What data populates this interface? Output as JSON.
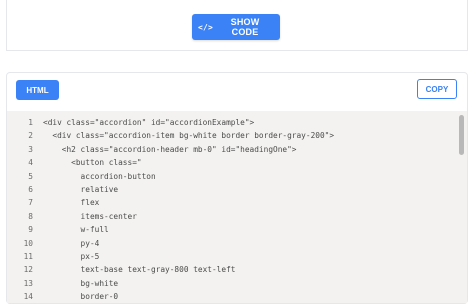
{
  "preview": {
    "show_code_label": "SHOW CODE",
    "icon_glyph": "</>"
  },
  "panel": {
    "tab_label": "HTML",
    "copy_label": "COPY"
  },
  "code_lines": [
    {
      "n": "1",
      "text": "<div class=\"accordion\" id=\"accordionExample\">"
    },
    {
      "n": "2",
      "text": "  <div class=\"accordion-item bg-white border border-gray-200\">"
    },
    {
      "n": "3",
      "text": "    <h2 class=\"accordion-header mb-0\" id=\"headingOne\">"
    },
    {
      "n": "4",
      "text": "      <button class=\""
    },
    {
      "n": "5",
      "text": "        accordion-button"
    },
    {
      "n": "6",
      "text": "        relative"
    },
    {
      "n": "7",
      "text": "        flex"
    },
    {
      "n": "8",
      "text": "        items-center"
    },
    {
      "n": "9",
      "text": "        w-full"
    },
    {
      "n": "10",
      "text": "        py-4"
    },
    {
      "n": "11",
      "text": "        px-5"
    },
    {
      "n": "12",
      "text": "        text-base text-gray-800 text-left"
    },
    {
      "n": "13",
      "text": "        bg-white"
    },
    {
      "n": "14",
      "text": "        border-0"
    }
  ],
  "colors": {
    "accent": "#3b82f6",
    "code_bg": "#f3f2f0"
  }
}
